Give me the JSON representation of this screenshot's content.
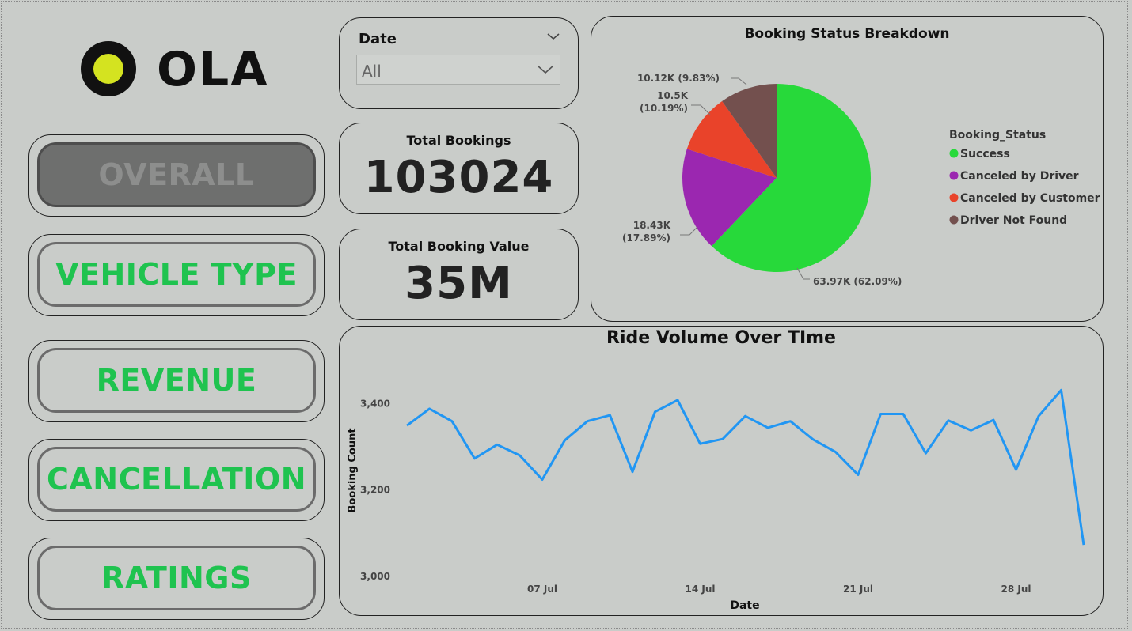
{
  "logo": {
    "text": "OLA",
    "ring_color": "#111111",
    "dot_color": "#d4e320"
  },
  "nav": {
    "items": [
      {
        "label": "OVERALL",
        "active": true
      },
      {
        "label": "VEHICLE TYPE",
        "active": false
      },
      {
        "label": "REVENUE",
        "active": false
      },
      {
        "label": "CANCELLATION",
        "active": false
      },
      {
        "label": "RATINGS",
        "active": false
      }
    ],
    "accent_color": "#1fc34f"
  },
  "slicer": {
    "label": "Date",
    "value": "All"
  },
  "kpis": {
    "total_bookings": {
      "title": "Total Bookings",
      "value": "103024"
    },
    "total_booking_value": {
      "title": "Total Booking Value",
      "value": "35M"
    }
  },
  "chart_data": [
    {
      "type": "pie",
      "title": "Booking Status Breakdown",
      "legend_title": "Booking_Status",
      "legend_position": "right",
      "slices": [
        {
          "name": "Success",
          "value": 63970,
          "label": "63.97K (62.09%)",
          "color": "#27d93a"
        },
        {
          "name": "Canceled by Driver",
          "value": 18430,
          "label": "18.43K (17.89%)",
          "color": "#9b27b0"
        },
        {
          "name": "Canceled by Customer",
          "value": 10500,
          "label": "10.5K (10.19%)",
          "color": "#e9432a"
        },
        {
          "name": "Driver Not Found",
          "value": 10120,
          "label": "10.12K (9.83%)",
          "color": "#73504e"
        }
      ]
    },
    {
      "type": "line",
      "title": "Ride Volume Over TIme",
      "xlabel": "Date",
      "ylabel": "Booking Count",
      "ylim": [
        3000,
        3450
      ],
      "yticks": [
        3000,
        3200,
        3400
      ],
      "ytick_labels": [
        "3,000",
        "3,200",
        "3,400"
      ],
      "xticks": [
        "07 Jul",
        "14 Jul",
        "21 Jul",
        "28 Jul"
      ],
      "xtick_days": [
        7,
        14,
        21,
        28
      ],
      "grid": false,
      "color": "#2196f3",
      "x": [
        1,
        2,
        3,
        4,
        5,
        6,
        7,
        8,
        9,
        10,
        11,
        12,
        13,
        14,
        15,
        16,
        17,
        18,
        19,
        20,
        21,
        22,
        23,
        24,
        25,
        26,
        27,
        28,
        29,
        30,
        31
      ],
      "values": [
        3349,
        3388,
        3359,
        3273,
        3305,
        3280,
        3224,
        3315,
        3359,
        3373,
        3242,
        3381,
        3408,
        3307,
        3318,
        3371,
        3344,
        3359,
        3317,
        3288,
        3235,
        3376,
        3376,
        3285,
        3361,
        3338,
        3362,
        3247,
        3371,
        3431,
        3073
      ]
    }
  ]
}
